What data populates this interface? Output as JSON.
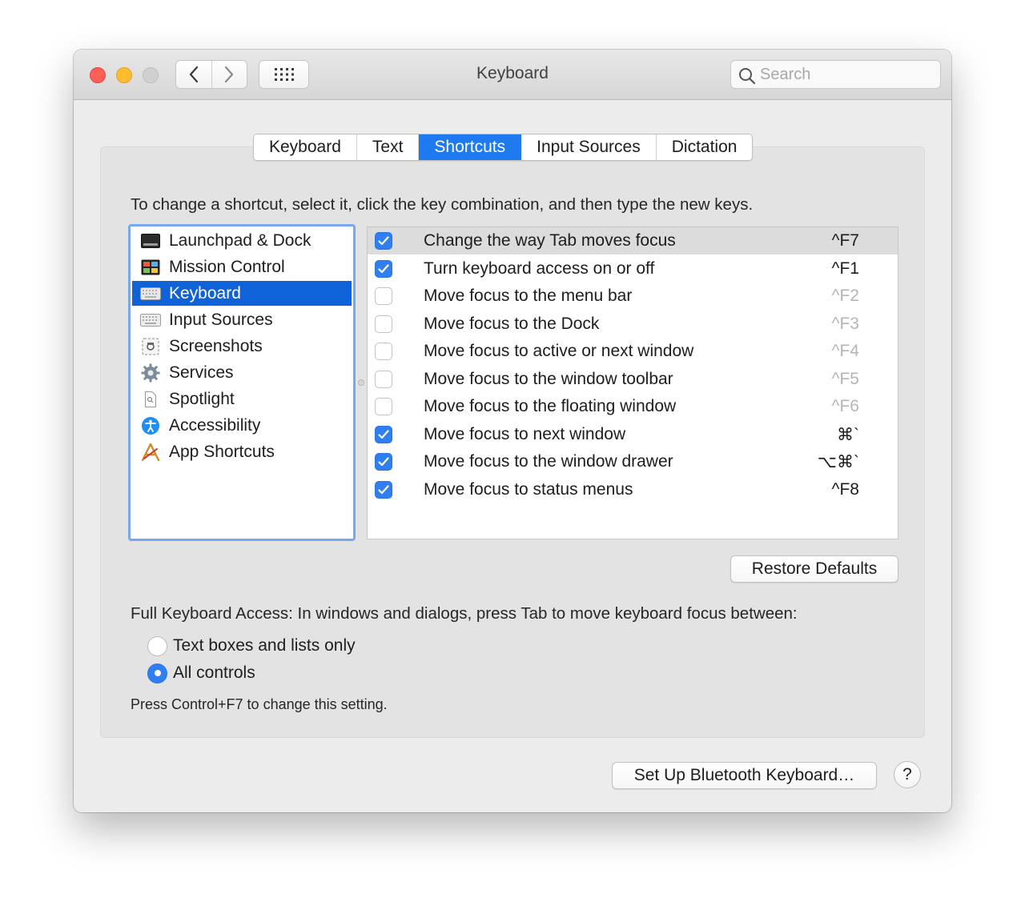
{
  "window": {
    "title": "Keyboard",
    "search_placeholder": "Search"
  },
  "tabs": [
    {
      "label": "Keyboard",
      "active": false
    },
    {
      "label": "Text",
      "active": false
    },
    {
      "label": "Shortcuts",
      "active": true
    },
    {
      "label": "Input Sources",
      "active": false
    },
    {
      "label": "Dictation",
      "active": false
    }
  ],
  "instruction": "To change a shortcut, select it, click the key combination, and then type the new keys.",
  "categories": [
    {
      "label": "Launchpad & Dock",
      "icon": "launchpad-icon",
      "selected": false
    },
    {
      "label": "Mission Control",
      "icon": "mission-control-icon",
      "selected": false
    },
    {
      "label": "Keyboard",
      "icon": "keyboard-icon",
      "selected": true
    },
    {
      "label": "Input Sources",
      "icon": "input-sources-icon",
      "selected": false
    },
    {
      "label": "Screenshots",
      "icon": "screenshots-icon",
      "selected": false
    },
    {
      "label": "Services",
      "icon": "services-gear-icon",
      "selected": false
    },
    {
      "label": "Spotlight",
      "icon": "spotlight-icon",
      "selected": false
    },
    {
      "label": "Accessibility",
      "icon": "accessibility-icon",
      "selected": false
    },
    {
      "label": "App Shortcuts",
      "icon": "app-shortcuts-icon",
      "selected": false
    }
  ],
  "shortcuts": [
    {
      "label": "Change the way Tab moves focus",
      "key": "^F7",
      "checked": true
    },
    {
      "label": "Turn keyboard access on or off",
      "key": "^F1",
      "checked": true
    },
    {
      "label": "Move focus to the menu bar",
      "key": "^F2",
      "checked": false
    },
    {
      "label": "Move focus to the Dock",
      "key": "^F3",
      "checked": false
    },
    {
      "label": "Move focus to active or next window",
      "key": "^F4",
      "checked": false
    },
    {
      "label": "Move focus to the window toolbar",
      "key": "^F5",
      "checked": false
    },
    {
      "label": "Move focus to the floating window",
      "key": "^F6",
      "checked": false
    },
    {
      "label": "Move focus to next window",
      "key": "⌘`",
      "checked": true
    },
    {
      "label": "Move focus to the window drawer",
      "key": "⌥⌘`",
      "checked": true
    },
    {
      "label": "Move focus to status menus",
      "key": "^F8",
      "checked": true
    }
  ],
  "restore_defaults_label": "Restore Defaults",
  "full_keyboard_access": {
    "label": "Full Keyboard Access: In windows and dialogs, press Tab to move keyboard focus between:",
    "options": [
      {
        "label": "Text boxes and lists only",
        "selected": false
      },
      {
        "label": "All controls",
        "selected": true
      }
    ],
    "hint": "Press Control+F7 to change this setting."
  },
  "bluetooth_button_label": "Set Up Bluetooth Keyboard…",
  "help_label": "?",
  "colors": {
    "accent": "#1f7af0",
    "selection": "#1062d8",
    "close": "#fe5f57",
    "minimize": "#febc2e"
  }
}
